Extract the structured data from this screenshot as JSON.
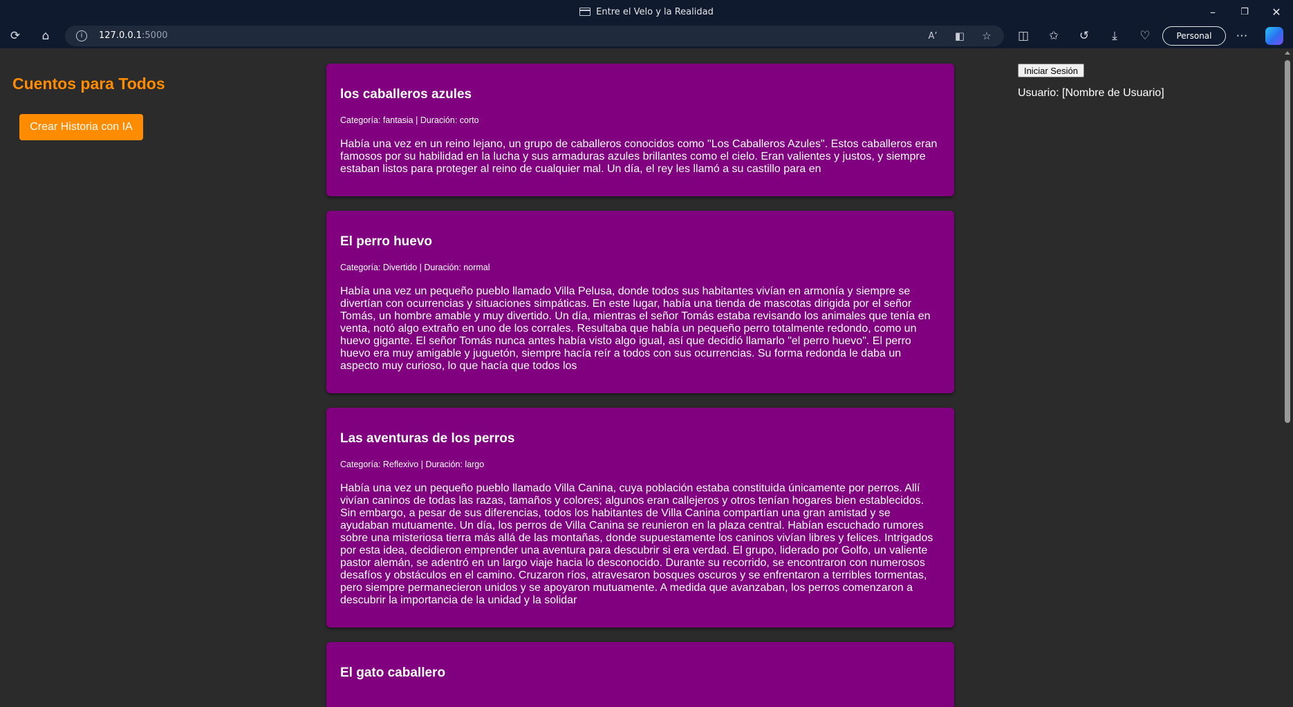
{
  "browser": {
    "window_title": "Entre el Velo y la Realidad",
    "url_host": "127.0.0.1",
    "url_port": ":5000",
    "profile_label": "Personal"
  },
  "sidebar": {
    "site_title": "Cuentos para Todos",
    "create_button": "Crear Historia con IA"
  },
  "account": {
    "login_button": "Iniciar Sesión",
    "user_label": "Usuario: [Nombre de Usuario]"
  },
  "stories": [
    {
      "title": "los caballeros azules",
      "meta": "Categoría: fantasia | Duración: corto",
      "body": "Había una vez en un reino lejano, un grupo de caballeros conocidos como \"Los Caballeros Azules\". Estos caballeros eran famosos por su habilidad en la lucha y sus armaduras azules brillantes como el cielo. Eran valientes y justos, y siempre estaban listos para proteger al reino de cualquier mal. Un día, el rey les llamó a su castillo para en"
    },
    {
      "title": "El perro huevo",
      "meta": "Categoría: Divertido | Duración: normal",
      "body": "Había una vez un pequeño pueblo llamado Villa Pelusa, donde todos sus habitantes vivían en armonía y siempre se divertían con ocurrencias y situaciones simpáticas. En este lugar, había una tienda de mascotas dirigida por el señor Tomás, un hombre amable y muy divertido. Un día, mientras el señor Tomás estaba revisando los animales que tenía en venta, notó algo extraño en uno de los corrales. Resultaba que había un pequeño perro totalmente redondo, como un huevo gigante. El señor Tomás nunca antes había visto algo igual, así que decidió llamarlo \"el perro huevo\". El perro huevo era muy amigable y juguetón, siempre hacía reír a todos con sus ocurrencias. Su forma redonda le daba un aspecto muy curioso, lo que hacía que todos los"
    },
    {
      "title": "Las aventuras de los perros",
      "meta": "Categoría: Reflexivo | Duración: largo",
      "body": "Había una vez un pequeño pueblo llamado Villa Canina, cuya población estaba constituida únicamente por perros. Allí vivían caninos de todas las razas, tamaños y colores; algunos eran callejeros y otros tenían hogares bien establecidos. Sin embargo, a pesar de sus diferencias, todos los habitantes de Villa Canina compartían una gran amistad y se ayudaban mutuamente. Un día, los perros de Villa Canina se reunieron en la plaza central. Habían escuchado rumores sobre una misteriosa tierra más allá de las montañas, donde supuestamente los caninos vivían libres y felices. Intrigados por esta idea, decidieron emprender una aventura para descubrir si era verdad. El grupo, liderado por Golfo, un valiente pastor alemán, se adentró en un largo viaje hacia lo desconocido. Durante su recorrido, se encontraron con numerosos desafíos y obstáculos en el camino. Cruzaron ríos, atravesaron bosques oscuros y se enfrentaron a terribles tormentas, pero siempre permanecieron unidos y se apoyaron mutuamente. A medida que avanzaban, los perros comenzaron a descubrir la importancia de la unidad y la solidar"
    },
    {
      "title": "El gato caballero",
      "meta": "",
      "body": ""
    }
  ],
  "colors": {
    "accent": "#ff8c00",
    "card": "#800080",
    "page_bg": "#2b2b2b",
    "chrome_bg": "#0f1a2e"
  }
}
